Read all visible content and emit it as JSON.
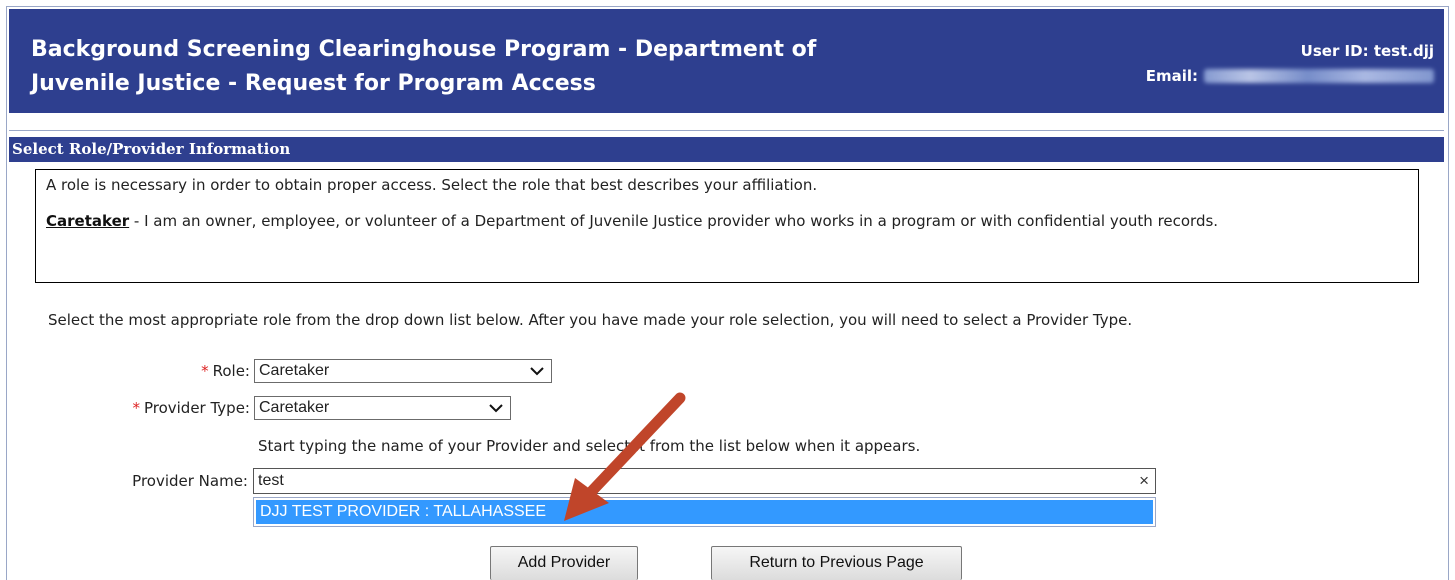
{
  "header": {
    "title": "Background Screening Clearinghouse Program - Department of Juvenile Justice - Request for Program Access",
    "user_id_label": "User ID:",
    "user_id_value": "test.djj",
    "email_label": "Email:"
  },
  "section": {
    "title": "Select Role/Provider Information"
  },
  "info": {
    "intro": "A role is necessary in order to obtain proper access. Select the role that best describes your affiliation.",
    "role_name": "Caretaker",
    "role_description": " - I am an owner, employee, or volunteer of a Department of Juvenile Justice provider who works in a program or with confidential youth records."
  },
  "form": {
    "instruction": "Select the most appropriate role from the drop down list below. After you have made your role selection, you will need to select a Provider Type.",
    "required_marker": "*",
    "role_label": "Role:",
    "role_value": "Caretaker",
    "provider_type_label": "Provider Type:",
    "provider_type_value": "Caretaker",
    "provider_hint": "Start typing the name of your Provider and select it from the list below when it appears.",
    "provider_name_label": "Provider Name:",
    "provider_name_value": "test",
    "clear_symbol": "×",
    "suggestions": [
      "DJJ TEST PROVIDER : TALLAHASSEE"
    ]
  },
  "buttons": {
    "add_provider": "Add Provider",
    "return_previous": "Return to Previous Page"
  },
  "colors": {
    "header_bg": "#2e3f8f",
    "highlight": "#3399ff",
    "annotation_arrow": "#c0452a",
    "required": "#d22222"
  }
}
